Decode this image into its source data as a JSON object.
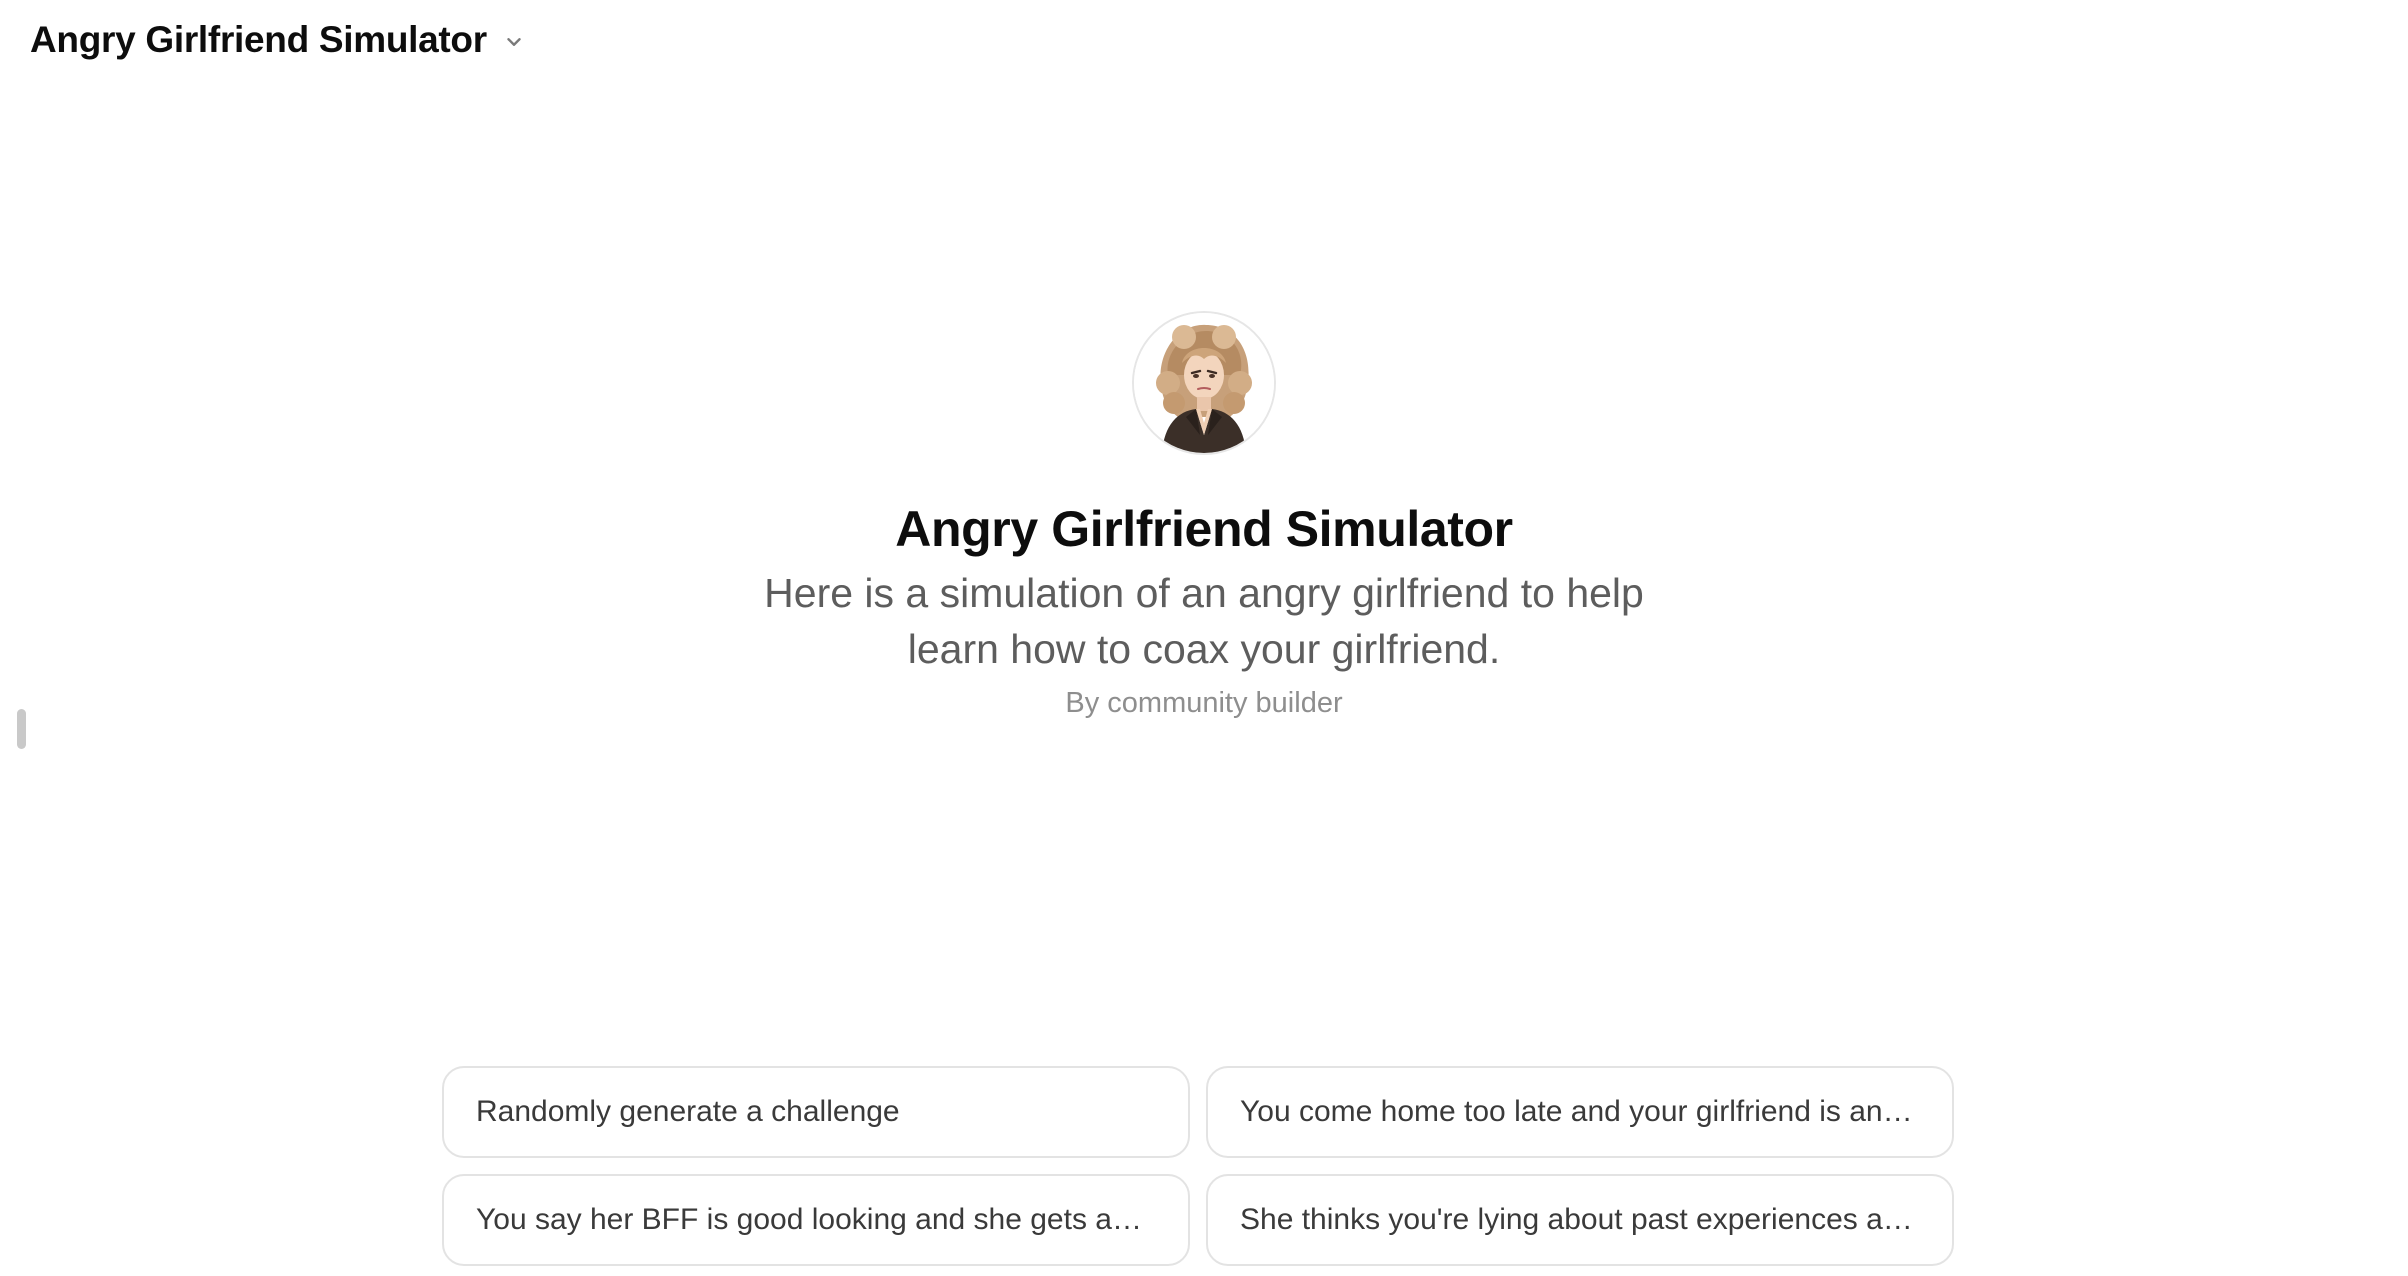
{
  "header": {
    "title": "Angry Girlfriend Simulator",
    "chevron_icon": "chevron-down-icon"
  },
  "hero": {
    "avatar_icon": "gpt-avatar",
    "title": "Angry Girlfriend Simulator",
    "description": "Here is a simulation of an angry girlfriend to help learn how to coax your girlfriend.",
    "author": "By community builder"
  },
  "prompts": [
    "Randomly generate a challenge",
    "You come home too late and your girlfriend is angry.",
    "You say her BFF is good looking and she gets angry.",
    "She thinks you're lying about past experiences and g..."
  ],
  "colors": {
    "text_primary": "#0d0d0d",
    "text_secondary": "#5d5d5d",
    "text_muted": "#8e8e8e",
    "card_border": "#e3e3e3"
  }
}
